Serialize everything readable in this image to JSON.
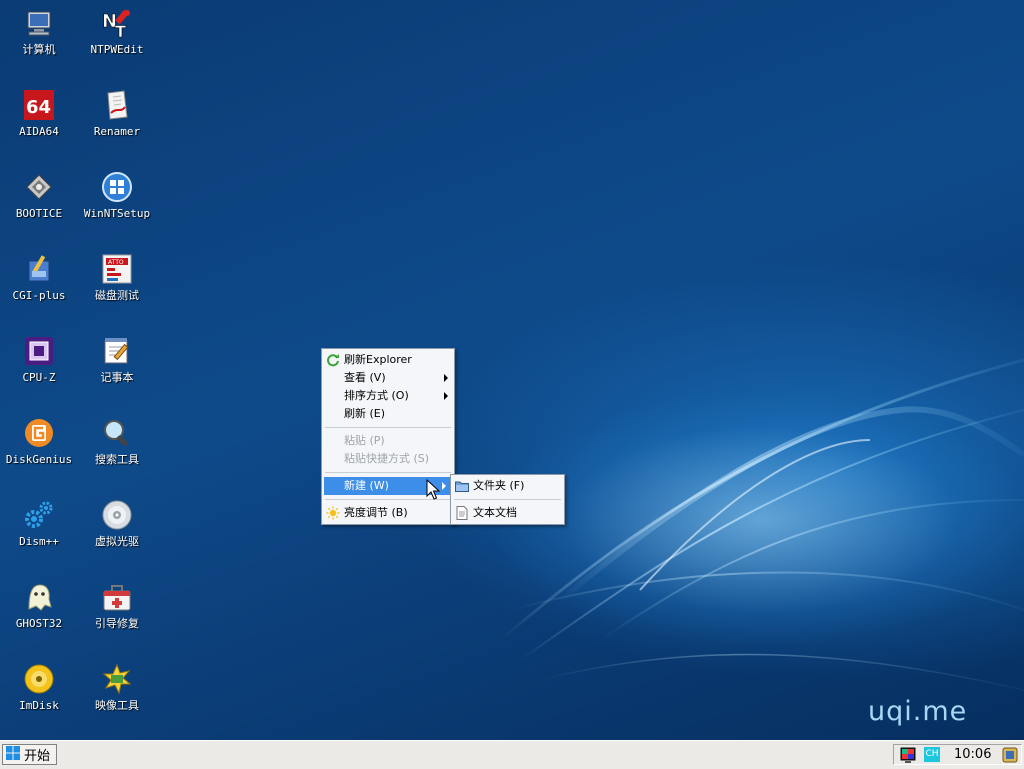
{
  "wallpaper": {
    "brand_text": "uqi.me"
  },
  "desktop_icons": [
    {
      "label": "计算机",
      "icon": "computer-icon"
    },
    {
      "label": "NTPWEdit",
      "icon": "ntpwedit-icon"
    },
    {
      "label": "AIDA64",
      "icon": "aida64-icon"
    },
    {
      "label": "Renamer",
      "icon": "renamer-icon"
    },
    {
      "label": "BOOTICE",
      "icon": "bootice-icon"
    },
    {
      "label": "WinNTSetup",
      "icon": "winntsetup-icon"
    },
    {
      "label": "CGI-plus",
      "icon": "cgi-plus-icon"
    },
    {
      "label": "磁盘测试",
      "icon": "disk-test-icon"
    },
    {
      "label": "CPU-Z",
      "icon": "cpu-z-icon"
    },
    {
      "label": "记事本",
      "icon": "notepad-icon"
    },
    {
      "label": "DiskGenius",
      "icon": "diskgenius-icon"
    },
    {
      "label": "搜索工具",
      "icon": "search-tool-icon"
    },
    {
      "label": "Dism++",
      "icon": "dism-icon"
    },
    {
      "label": "虚拟光驱",
      "icon": "virtual-drive-icon"
    },
    {
      "label": "GHOST32",
      "icon": "ghost32-icon"
    },
    {
      "label": "引导修复",
      "icon": "boot-repair-icon"
    },
    {
      "label": "ImDisk",
      "icon": "imdisk-icon"
    },
    {
      "label": "映像工具",
      "icon": "image-tool-icon"
    }
  ],
  "context_menu": {
    "items": [
      {
        "label": "刷新Explorer",
        "icon": "refresh-icon"
      },
      {
        "label": "查看 (V)",
        "submenu": true
      },
      {
        "label": "排序方式 (O)",
        "submenu": true
      },
      {
        "label": "刷新 (E)"
      },
      {
        "label": "粘贴 (P)",
        "disabled": true
      },
      {
        "label": "粘贴快捷方式 (S)",
        "disabled": true
      },
      {
        "label": "新建 (W)",
        "submenu": true,
        "highlighted": true
      },
      {
        "label": "亮度调节 (B)",
        "icon": "brightness-icon"
      }
    ]
  },
  "submenu_new": {
    "items": [
      {
        "label": "文件夹 (F)",
        "icon": "folder-icon"
      },
      {
        "label": "文本文档",
        "icon": "text-document-icon"
      }
    ]
  },
  "taskbar": {
    "start_label": "开始",
    "tray": {
      "ime_label": "CH",
      "clock": "10:06"
    }
  },
  "colors": {
    "desktop": "#0c3f77",
    "menu_highlight": "#3d8ee8",
    "taskbar": "#eceae6"
  }
}
